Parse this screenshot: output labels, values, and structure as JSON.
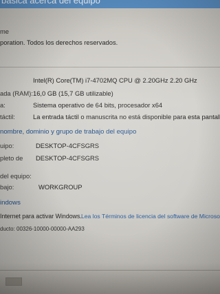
{
  "window": {
    "title_partial": "básica acerca del equipo"
  },
  "edition": {
    "label_partial": "me",
    "copyright_partial": "poration. Todos los derechos reservados."
  },
  "system": {
    "processor_value": "Intel(R) Core(TM) i7-4702MQ CPU @ 2.20GHz   2.20 GHz",
    "ram_label_partial": "ada (RAM):",
    "ram_value": "16,0 GB (15,7 GB utilizable)",
    "type_label_partial": "a:",
    "type_value": "Sistema operativo de 64 bits, procesador x64",
    "pen_label_partial": "táctil:",
    "pen_value": "La entrada táctil o manuscrita no está disponible para esta pantalla"
  },
  "computer_name": {
    "section_partial": "nombre, dominio y grupo de trabajo del equipo",
    "name_label_partial": "uipo:",
    "name_value": "DESKTOP-4CFSGRS",
    "fullname_label_partial": "pleto de",
    "fullname_value": "DESKTOP-4CFSGRS",
    "desc_label_partial": "del equipo:",
    "workgroup_label_partial": "bajo:",
    "workgroup_value": "WORKGROUP"
  },
  "activation": {
    "section_partial": "indows",
    "status_partial": "Internet para activar Windows.",
    "terms_link": "Lea los Términos de licencia del software de Microsoft",
    "product_id_partial": "ducto: 00326-10000-00000-AA293"
  }
}
